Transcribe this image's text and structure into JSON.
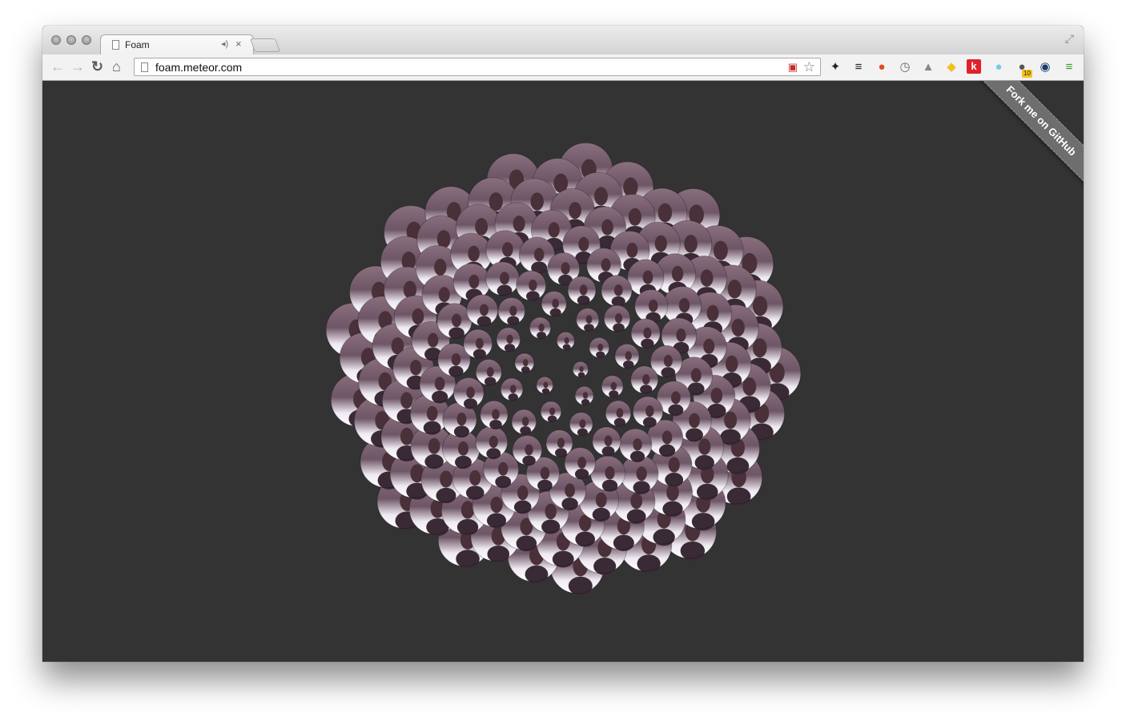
{
  "browser": {
    "tab_title": "Foam",
    "tab_audio_icon": "speaker-icon",
    "tab_close_label": "×",
    "url": "foam.meteor.com",
    "back_icon": "back-arrow-icon",
    "forward_icon": "forward-arrow-icon",
    "reload_icon": "reload-icon",
    "home_icon": "home-icon"
  },
  "extensions": {
    "k_label": "k",
    "badge_count": "10",
    "colors": {
      "k_bg": "#e0202a",
      "menu": "#3a9a2e"
    }
  },
  "page": {
    "ribbon_text": "Fork me on GitHub",
    "background": "#333333",
    "ribbon_color": "#6e6e6e"
  }
}
